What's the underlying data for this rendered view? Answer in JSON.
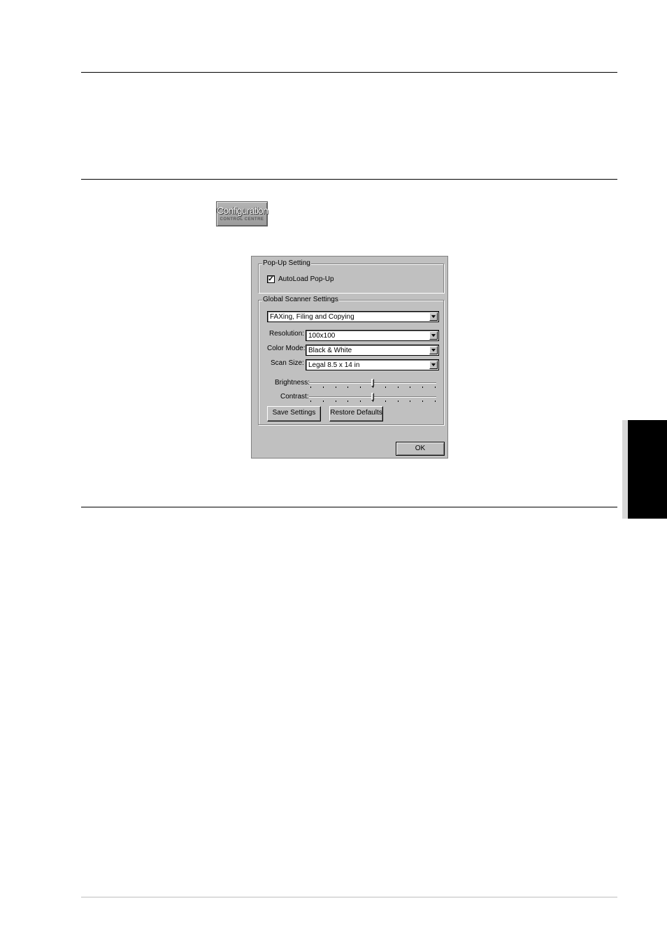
{
  "config_button": {
    "title": "Configuration",
    "subtitle": "CONTROL CENTRE"
  },
  "dialog": {
    "popup_group": {
      "label": "Pop-Up Setting",
      "autoload_label": "AutoLoad Pop-Up",
      "autoload_checked": true,
      "check_mark": "✓"
    },
    "scanner_group": {
      "label": "Global Scanner Settings",
      "mode_select": "FAXing, Filing and Copying",
      "resolution_label": "Resolution:",
      "resolution_value": "100x100",
      "color_mode_label": "Color Mode:",
      "color_mode_value": "Black & White",
      "scan_size_label": "Scan Size:",
      "scan_size_value": "Legal 8.5 x 14 in",
      "brightness_label": "Brightness:",
      "brightness_level": 0.5,
      "contrast_label": "Contrast:",
      "contrast_level": 0.5,
      "save_button": "Save Settings",
      "restore_button": "Restore Defaults"
    },
    "ok_button": "OK"
  }
}
